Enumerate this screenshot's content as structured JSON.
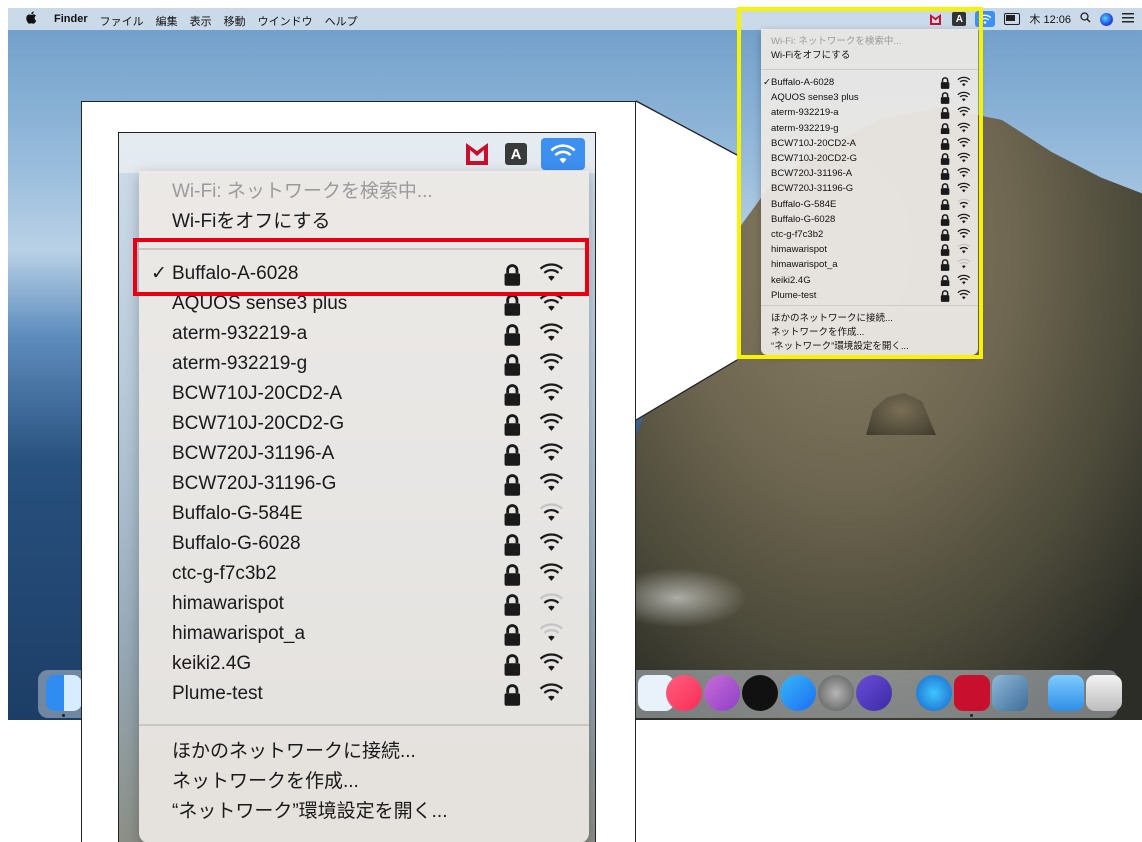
{
  "menubar": {
    "apple": "",
    "menus": [
      "Finder",
      "ファイル",
      "編集",
      "表示",
      "移動",
      "ウインドウ",
      "ヘルプ"
    ],
    "icons": [
      "mcafee-icon",
      "keyboard-a-icon",
      "wifi-icon",
      "battery-icon",
      "search-icon",
      "siri-icon",
      "list-icon"
    ],
    "a_label": "A",
    "clock": "木 12:06"
  },
  "wifi_menu": {
    "status": "Wi-Fi: ネットワークを検索中...",
    "status_small": "Wi-Fi: ネットワークを検索中...",
    "toggle": "Wi-Fiをオフにする",
    "check": "✓",
    "networks": [
      {
        "name": "Buffalo-A-6028",
        "connected": true,
        "locked": true,
        "strength": 3
      },
      {
        "name": "AQUOS sense3 plus",
        "connected": false,
        "locked": true,
        "strength": 3
      },
      {
        "name": "aterm-932219-a",
        "connected": false,
        "locked": true,
        "strength": 3
      },
      {
        "name": "aterm-932219-g",
        "connected": false,
        "locked": true,
        "strength": 3
      },
      {
        "name": "BCW710J-20CD2-A",
        "connected": false,
        "locked": true,
        "strength": 3
      },
      {
        "name": "BCW710J-20CD2-G",
        "connected": false,
        "locked": true,
        "strength": 3
      },
      {
        "name": "BCW720J-31196-A",
        "connected": false,
        "locked": true,
        "strength": 3
      },
      {
        "name": "BCW720J-31196-G",
        "connected": false,
        "locked": true,
        "strength": 3
      },
      {
        "name": "Buffalo-G-584E",
        "connected": false,
        "locked": true,
        "strength": 2
      },
      {
        "name": "Buffalo-G-6028",
        "connected": false,
        "locked": true,
        "strength": 3
      },
      {
        "name": "ctc-g-f7c3b2",
        "connected": false,
        "locked": true,
        "strength": 3
      },
      {
        "name": "himawarispot",
        "connected": false,
        "locked": true,
        "strength": 2
      },
      {
        "name": "himawarispot_a",
        "connected": false,
        "locked": true,
        "strength": 1
      },
      {
        "name": "keiki2.4G",
        "connected": false,
        "locked": true,
        "strength": 3
      },
      {
        "name": "Plume-test",
        "connected": false,
        "locked": true,
        "strength": 3
      }
    ],
    "actions": [
      "ほかのネットワークに接続...",
      "ネットワークを作成...",
      "“ネットワーク”環境設定を開く..."
    ],
    "actions_small": [
      "ほかのネットワークに接続...",
      "ネットワークを作成...",
      "“ネットワーク”環境設定を開く..."
    ]
  },
  "highlight": {
    "red_box_color": "#e60012",
    "yellow_box_color": "#f8f300"
  }
}
